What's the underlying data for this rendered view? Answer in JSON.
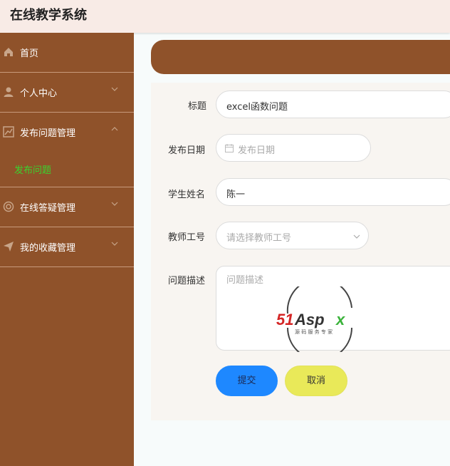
{
  "app": {
    "title": "在线教学系统"
  },
  "sidebar": {
    "items": [
      {
        "label": "首页",
        "icon": "home-icon"
      },
      {
        "label": "个人中心",
        "icon": "user-icon"
      },
      {
        "label": "发布问题管理",
        "icon": "chart-icon"
      },
      {
        "label": "在线答疑管理",
        "icon": "support-icon"
      },
      {
        "label": "我的收藏管理",
        "icon": "send-icon"
      }
    ],
    "subitems": [
      {
        "label": "发布问题",
        "active_color": "#3ad32f"
      }
    ]
  },
  "form": {
    "title": {
      "label": "标题",
      "value": "excel函数问题"
    },
    "publish_date": {
      "label": "发布日期",
      "placeholder": "发布日期"
    },
    "student_name": {
      "label": "学生姓名",
      "value": "陈一"
    },
    "teacher_id": {
      "label": "教师工号",
      "placeholder": "请选择教师工号"
    },
    "description": {
      "label": "问题描述",
      "placeholder": "问题描述"
    },
    "submit_label": "提交",
    "cancel_label": "取消"
  },
  "watermark": {
    "brand": "51Aspx",
    "tagline": "源 码 服 务 专 家"
  },
  "colors": {
    "sidebar": "#8f522a",
    "active_menu_text": "#3ad32f",
    "submit_button": "#1e88ff",
    "cancel_button": "#e9e959"
  }
}
